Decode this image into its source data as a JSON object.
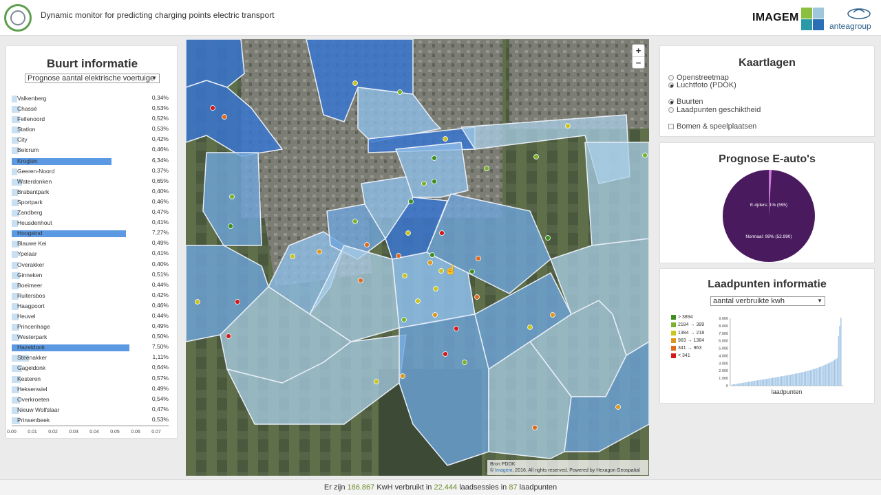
{
  "header": {
    "title": "Dynamic monitor for predicting charging points electric transport",
    "imagem_logo": "IMAGEM",
    "antea_logo": "anteagroup"
  },
  "buurt": {
    "title": "Buurt informatie",
    "select_value": "Prognose aantal elektrische voertuige",
    "rows": [
      {
        "name": "Valkenberg",
        "value": "0,34%",
        "frac": 0.034
      },
      {
        "name": "Chassé",
        "value": "0,53%",
        "frac": 0.053
      },
      {
        "name": "Fellenoord",
        "value": "0,52%",
        "frac": 0.052
      },
      {
        "name": "Station",
        "value": "0,53%",
        "frac": 0.053
      },
      {
        "name": "City",
        "value": "0,42%",
        "frac": 0.042
      },
      {
        "name": "Belcrum",
        "value": "0,46%",
        "frac": 0.046
      },
      {
        "name": "Krogten",
        "value": "6,34%",
        "frac": 0.634
      },
      {
        "name": "Geeren-Noord",
        "value": "0,37%",
        "frac": 0.037
      },
      {
        "name": "Waterdonken",
        "value": "0,65%",
        "frac": 0.065
      },
      {
        "name": "Brabantpark",
        "value": "0,40%",
        "frac": 0.04
      },
      {
        "name": "Sportpark",
        "value": "0,46%",
        "frac": 0.046
      },
      {
        "name": "Zandberg",
        "value": "0,47%",
        "frac": 0.047
      },
      {
        "name": "Heusdenhout",
        "value": "0,41%",
        "frac": 0.041
      },
      {
        "name": "Hoogeind",
        "value": "7,27%",
        "frac": 0.727
      },
      {
        "name": "Blauwe Kei",
        "value": "0,49%",
        "frac": 0.049
      },
      {
        "name": "Ypelaar",
        "value": "0,41%",
        "frac": 0.041
      },
      {
        "name": "Overakker",
        "value": "0,40%",
        "frac": 0.04
      },
      {
        "name": "Ginneken",
        "value": "0,51%",
        "frac": 0.051
      },
      {
        "name": "Boeimeer",
        "value": "0,44%",
        "frac": 0.044
      },
      {
        "name": "Ruitersbos",
        "value": "0,42%",
        "frac": 0.042
      },
      {
        "name": "Haagpoort",
        "value": "0,46%",
        "frac": 0.046
      },
      {
        "name": "Heuvel",
        "value": "0,44%",
        "frac": 0.044
      },
      {
        "name": "Princenhage",
        "value": "0,49%",
        "frac": 0.049
      },
      {
        "name": "Westerpark",
        "value": "0,50%",
        "frac": 0.05
      },
      {
        "name": "Hazeldonk",
        "value": "7,50%",
        "frac": 0.75
      },
      {
        "name": "Steenakker",
        "value": "1,11%",
        "frac": 0.111
      },
      {
        "name": "Gageldonk",
        "value": "0,64%",
        "frac": 0.064
      },
      {
        "name": "Kesteren",
        "value": "0,57%",
        "frac": 0.057
      },
      {
        "name": "Heksenwiel",
        "value": "0,49%",
        "frac": 0.049
      },
      {
        "name": "Overkroeten",
        "value": "0,54%",
        "frac": 0.054
      },
      {
        "name": "Nieuw Wolfslaar",
        "value": "0,47%",
        "frac": 0.047
      },
      {
        "name": "Prinsenbeek",
        "value": "0,53%",
        "frac": 0.053
      }
    ],
    "ticks": [
      "0.00",
      "0.01",
      "0.02",
      "0.03",
      "0.04",
      "0.05",
      "0.06",
      "0.07"
    ]
  },
  "map": {
    "zoom_in": "+",
    "zoom_out": "−",
    "attribution_source": "Bron PDOK",
    "attribution_copy": "©",
    "attribution_link": "Imagem",
    "attribution_rest": ", 2016. All rights reserved. Powered by Hexagon Geospatial"
  },
  "kaartlagen": {
    "title": "Kaartlagen",
    "base_layers": [
      {
        "label": "Openstreetmap",
        "checked": false
      },
      {
        "label": "Luchtfoto (PDOK)",
        "checked": true
      }
    ],
    "overlay_layers": [
      {
        "label": "Buurten",
        "checked": true
      },
      {
        "label": "Laadpunten geschiktheid",
        "checked": false
      }
    ],
    "extra_layer": {
      "label": "Bomen & speelplaatsen",
      "checked": false
    }
  },
  "prognose": {
    "title": "Prognose E-auto's",
    "label_erijders": "E-rijders: 1% (595)",
    "label_normaal": "Normaal: 99% (52.990)"
  },
  "laadpunten": {
    "title": "Laadpunten informatie",
    "select_value": "aantal verbruikte kwh",
    "legend": [
      {
        "label": "> 3894",
        "color": "#3e8f1f"
      },
      {
        "label": "2184 → 399",
        "color": "#7ab22e"
      },
      {
        "label": "1384 → 218",
        "color": "#c9c41e"
      },
      {
        "label": "963 → 1384",
        "color": "#e0961a"
      },
      {
        "label": "341 → 963",
        "color": "#e06a1c"
      },
      {
        "label": "< 341",
        "color": "#d31919"
      }
    ],
    "xlabel": "laadpunten",
    "yticks": [
      "0",
      "1.000",
      "2.000",
      "3.000",
      "4.000",
      "5.000",
      "6.000",
      "7.000",
      "8.000",
      "9.000"
    ]
  },
  "chart_data": {
    "type": "pie",
    "title": "Prognose E-auto's",
    "slices": [
      {
        "name": "E-rijders",
        "value": 595,
        "percent": 1
      },
      {
        "name": "Normaal",
        "value": 52990,
        "percent": 99
      }
    ]
  },
  "footer": {
    "prefix": "Er zijn ",
    "kwh": "186.867",
    "mid1": " KwH verbruikt in ",
    "sessions": "22.444",
    "mid2": " laadsessies in ",
    "points": "87",
    "suffix": " laadpunten"
  },
  "colors": {
    "bar": "#c9dff2",
    "bar_highlight": "#5b9ae3",
    "pie_main": "#4a1a5e",
    "pie_small": "#c879d6"
  }
}
